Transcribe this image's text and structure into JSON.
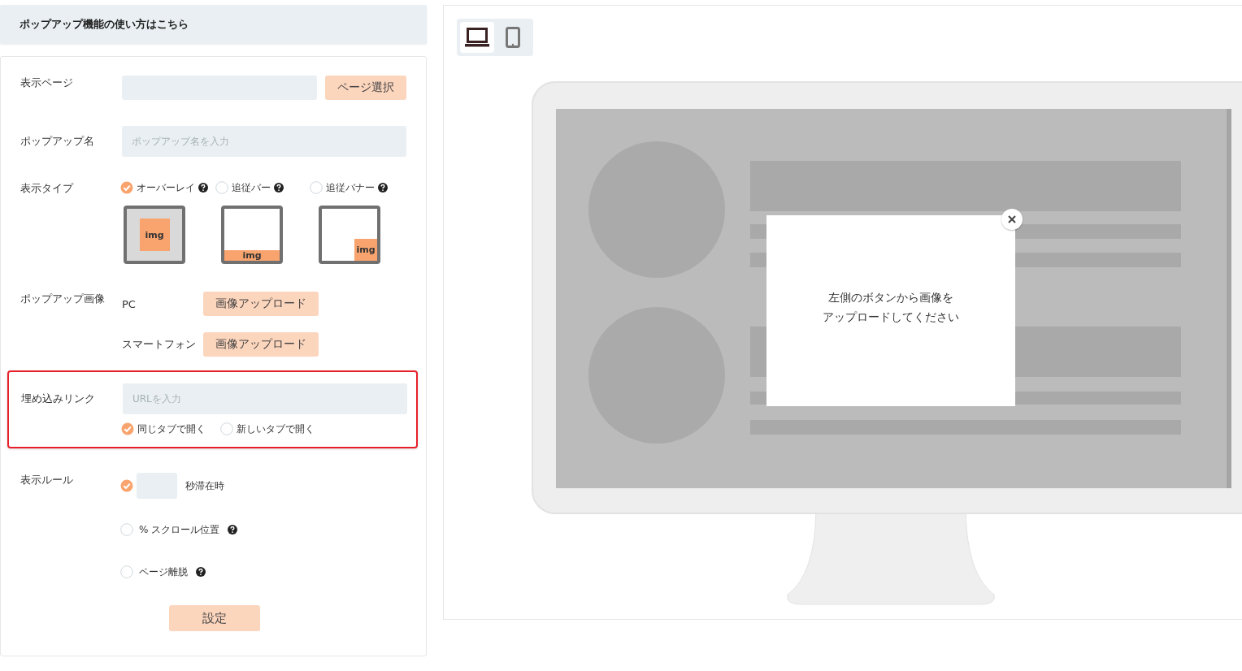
{
  "help_header": {
    "title": "ポップアップ機能の使い方はこちら"
  },
  "form": {
    "display_page": {
      "label": "表示ページ",
      "button": "ページ選択"
    },
    "popup_name": {
      "label": "ポップアップ名",
      "placeholder": "ポップアップ名を入力"
    },
    "display_type": {
      "label": "表示タイプ",
      "options": [
        {
          "kind": "overlay",
          "label": "オーバーレイ",
          "selected": true,
          "thumb_label": "img"
        },
        {
          "kind": "bar",
          "label": "追従バー",
          "selected": false,
          "thumb_label": "img"
        },
        {
          "kind": "banner",
          "label": "追従バナー",
          "selected": false,
          "thumb_label": "img"
        }
      ]
    },
    "popup_image": {
      "label": "ポップアップ画像",
      "rows": [
        {
          "device": "PC",
          "button": "画像アップロード"
        },
        {
          "device": "スマートフォン",
          "button": "画像アップロード"
        }
      ]
    },
    "embed_link": {
      "label": "埋め込みリンク",
      "placeholder": "URLを入力",
      "highlighted": true,
      "options": [
        {
          "label": "同じタブで開く",
          "selected": true
        },
        {
          "label": "新しいタブで開く",
          "selected": false
        }
      ]
    },
    "display_rules": {
      "label": "表示ルール",
      "rules": [
        {
          "kind": "seconds",
          "label": "秒滞在時",
          "checked": true,
          "help": false
        },
        {
          "kind": "text",
          "label": "% スクロール位置",
          "checked": false,
          "help": true
        },
        {
          "kind": "text",
          "label": "ページ離脱",
          "checked": false,
          "help": true
        }
      ]
    },
    "submit": "設定"
  },
  "preview": {
    "devices": [
      {
        "kind": "laptop",
        "selected": true
      },
      {
        "kind": "phone",
        "selected": false
      }
    ],
    "popup_message": [
      "左側のボタンから画像を",
      "アップロードしてください"
    ]
  }
}
